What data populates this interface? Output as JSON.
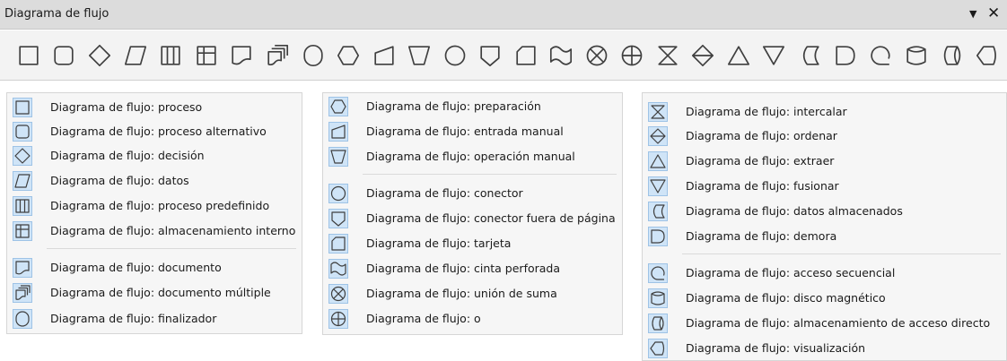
{
  "window": {
    "title": "Diagrama de flujo",
    "menu_glyph": "▼",
    "close_glyph": "✕"
  },
  "toolbar": {
    "icons": [
      "process-icon",
      "alternate-process-icon",
      "decision-icon",
      "data-icon",
      "predefined-process-icon",
      "internal-storage-icon",
      "document-icon",
      "multidocument-icon",
      "terminator-icon",
      "preparation-icon",
      "manual-input-icon",
      "manual-operation-icon",
      "connector-icon",
      "off-page-connector-icon",
      "card-icon",
      "punched-tape-icon",
      "summing-junction-icon",
      "or-icon",
      "collate-icon",
      "sort-icon",
      "extract-icon",
      "merge-icon",
      "stored-data-icon",
      "delay-icon",
      "sequential-access-icon",
      "magnetic-disk-icon",
      "direct-access-storage-icon",
      "display-icon"
    ]
  },
  "panels": {
    "left": [
      {
        "icon": "process-icon",
        "label": "Diagrama de flujo: proceso"
      },
      {
        "icon": "alternate-process-icon",
        "label": "Diagrama de flujo: proceso alternativo"
      },
      {
        "icon": "decision-icon",
        "label": "Diagrama de flujo: decisión"
      },
      {
        "icon": "data-icon",
        "label": "Diagrama de flujo: datos"
      },
      {
        "icon": "predefined-process-icon",
        "label": "Diagrama de flujo: proceso predefinido"
      },
      {
        "icon": "internal-storage-icon",
        "label": "Diagrama de flujo: almacenamiento interno"
      },
      {
        "icon": "document-icon",
        "label": "Diagrama de flujo: documento"
      },
      {
        "icon": "multidocument-icon",
        "label": "Diagrama de flujo: documento múltiple"
      },
      {
        "icon": "terminator-icon",
        "label": "Diagrama de flujo: finalizador"
      }
    ],
    "middle": [
      {
        "icon": "preparation-icon",
        "label": "Diagrama de flujo: preparación"
      },
      {
        "icon": "manual-input-icon",
        "label": "Diagrama de flujo: entrada manual"
      },
      {
        "icon": "manual-operation-icon",
        "label": "Diagrama de flujo: operación manual"
      },
      {
        "icon": "connector-icon",
        "label": "Diagrama de flujo: conector"
      },
      {
        "icon": "off-page-connector-icon",
        "label": "Diagrama de flujo: conector fuera de página"
      },
      {
        "icon": "card-icon",
        "label": "Diagrama de flujo: tarjeta"
      },
      {
        "icon": "punched-tape-icon",
        "label": "Diagrama de flujo: cinta perforada"
      },
      {
        "icon": "summing-junction-icon",
        "label": "Diagrama de flujo: unión de suma"
      },
      {
        "icon": "or-icon",
        "label": "Diagrama de flujo: o"
      }
    ],
    "right": [
      {
        "icon": "collate-icon",
        "label": "Diagrama de flujo: intercalar"
      },
      {
        "icon": "sort-icon",
        "label": "Diagrama de flujo: ordenar"
      },
      {
        "icon": "extract-icon",
        "label": "Diagrama de flujo: extraer"
      },
      {
        "icon": "merge-icon",
        "label": "Diagrama de flujo: fusionar"
      },
      {
        "icon": "stored-data-icon",
        "label": "Diagrama de flujo: datos almacenados"
      },
      {
        "icon": "delay-icon",
        "label": "Diagrama de flujo: demora"
      },
      {
        "icon": "sequential-access-icon",
        "label": "Diagrama de flujo: acceso secuencial"
      },
      {
        "icon": "magnetic-disk-icon",
        "label": "Diagrama de flujo: disco magnético"
      },
      {
        "icon": "direct-access-storage-icon",
        "label": "Diagrama de flujo: almacenamiento de acceso directo"
      },
      {
        "icon": "display-icon",
        "label": "Diagrama de flujo: visualización"
      }
    ]
  }
}
